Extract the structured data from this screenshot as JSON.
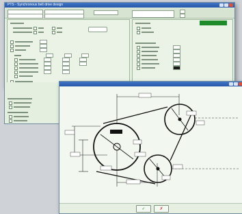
{
  "back_window": {
    "title": "PTS - Synchronous belt drive design"
  },
  "front_window": {
    "title": "",
    "ok_label": "✓",
    "cancel_label": "✗"
  },
  "colors": {
    "titlebar": "#2e5fb0",
    "panel": "#e4efdf",
    "ok": "#1d8a2a",
    "cancel": "#c9342a"
  }
}
